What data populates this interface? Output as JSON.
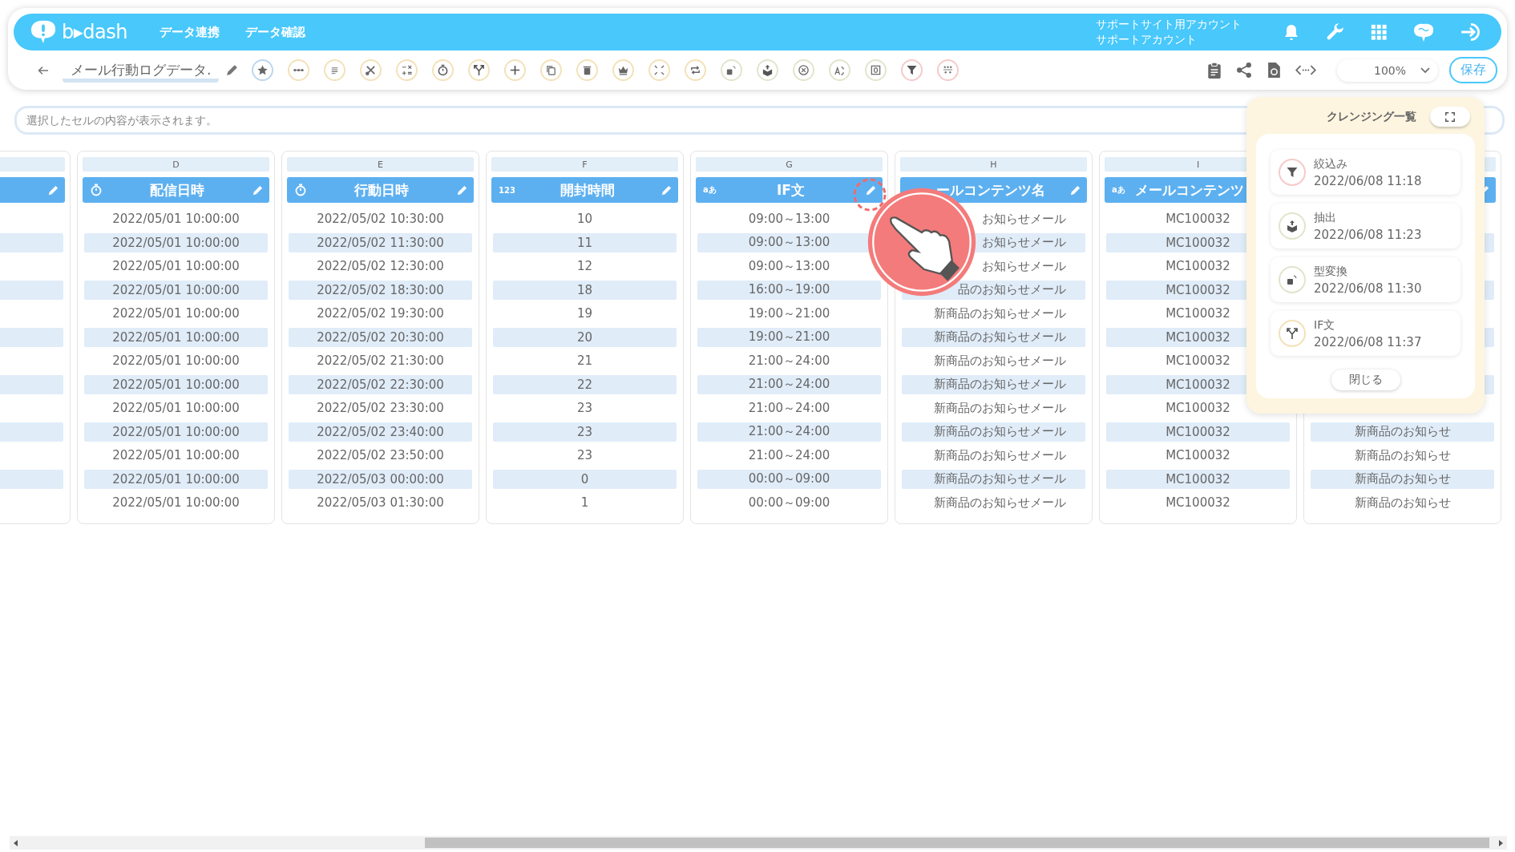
{
  "header": {
    "brand": "b▸dash",
    "nav": [
      {
        "label": "データ連携"
      },
      {
        "label": "データ確認"
      }
    ],
    "account": [
      "サポートサイト用アカウント",
      "サポートアカウント"
    ]
  },
  "toolbar": {
    "title": "メール行動ログデータ.",
    "zoom": "100%",
    "save": "保存"
  },
  "formula_bar": {
    "placeholder": "選択したセルの内容が表示されます。"
  },
  "columns": [
    {},
    {
      "letter": "D",
      "kind": "datetime",
      "label": "配信日時",
      "cells": [
        "2022/05/01 10:00:00",
        "2022/05/01 10:00:00",
        "2022/05/01 10:00:00",
        "2022/05/01 10:00:00",
        "2022/05/01 10:00:00",
        "2022/05/01 10:00:00",
        "2022/05/01 10:00:00",
        "2022/05/01 10:00:00",
        "2022/05/01 10:00:00",
        "2022/05/01 10:00:00",
        "2022/05/01 10:00:00",
        "2022/05/01 10:00:00",
        "2022/05/01 10:00:00"
      ]
    },
    {
      "letter": "E",
      "kind": "datetime",
      "label": "行動日時",
      "cells": [
        "2022/05/02 10:30:00",
        "2022/05/02 11:30:00",
        "2022/05/02 12:30:00",
        "2022/05/02 18:30:00",
        "2022/05/02 19:30:00",
        "2022/05/02 20:30:00",
        "2022/05/02 21:30:00",
        "2022/05/02 22:30:00",
        "2022/05/02 23:30:00",
        "2022/05/02 23:40:00",
        "2022/05/02 23:50:00",
        "2022/05/03 00:00:00",
        "2022/05/03 01:30:00"
      ]
    },
    {
      "letter": "F",
      "kind": "number",
      "type_mark": "123",
      "label": "開封時間",
      "cells": [
        "10",
        "11",
        "12",
        "18",
        "19",
        "20",
        "21",
        "22",
        "23",
        "23",
        "23",
        "0",
        "1"
      ]
    },
    {
      "letter": "G",
      "kind": "text",
      "type_mark": "aあ",
      "label": "IF文",
      "cells": [
        "09:00～13:00",
        "09:00～13:00",
        "09:00～13:00",
        "16:00～19:00",
        "19:00～21:00",
        "19:00～21:00",
        "21:00～24:00",
        "21:00～24:00",
        "21:00～24:00",
        "21:00～24:00",
        "21:00～24:00",
        "00:00～09:00",
        "00:00～09:00"
      ]
    },
    {
      "letter": "H",
      "label": "ールコンテンツ名",
      "cells": [
        "お知らせメール",
        "お知らせメール",
        "お知らせメール",
        "品のお知らせメール",
        "新商品のお知らせメール",
        "新商品のお知らせメール",
        "新商品のお知らせメール",
        "新商品のお知らせメール",
        "新商品のお知らせメール",
        "新商品のお知らせメール",
        "新商品のお知らせメール",
        "新商品のお知らせメール",
        "新商品のお知らせメール"
      ]
    },
    {
      "letter": "I",
      "kind": "text",
      "type_mark": "aあ",
      "label": "メールコンテンツ",
      "cells": [
        "MC100032",
        "MC100032",
        "MC100032",
        "MC100032",
        "MC100032",
        "MC100032",
        "MC100032",
        "MC100032",
        "MC100032",
        "MC100032",
        "MC100032",
        "MC100032",
        "MC100032"
      ]
    },
    {
      "cells": [
        null,
        null,
        null,
        null,
        null,
        null,
        null,
        null,
        null,
        "新商品のお知らせ",
        "新商品のお知らせ",
        "新商品のお知らせ",
        "新商品のお知らせ"
      ]
    }
  ],
  "cleansing_panel": {
    "title": "クレンジング一覧",
    "items": [
      {
        "kind": "filter",
        "name": "絞込み",
        "time": "2022/06/08 11:18"
      },
      {
        "kind": "extract",
        "name": "抽出",
        "time": "2022/06/08 11:23"
      },
      {
        "kind": "convert",
        "name": "型変換",
        "time": "2022/06/08 11:30"
      },
      {
        "kind": "if",
        "name": "IF文",
        "time": "2022/06/08 11:37"
      }
    ],
    "close": "閉じる"
  }
}
